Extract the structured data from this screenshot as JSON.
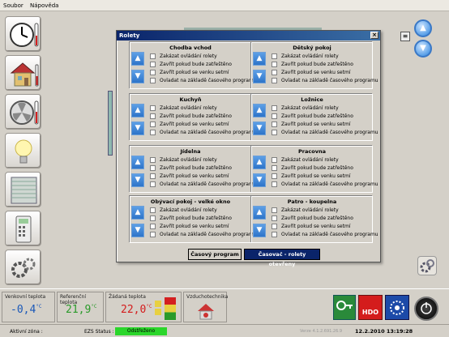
{
  "menu": [
    "Soubor",
    "Nápověda"
  ],
  "dialog": {
    "title": "Rolety",
    "close": "×",
    "rooms": [
      {
        "name": "Chodba vchod"
      },
      {
        "name": "Dětský pokoj"
      },
      {
        "name": "Kuchyň"
      },
      {
        "name": "Ložnice"
      },
      {
        "name": "Jídelna"
      },
      {
        "name": "Pracovna"
      },
      {
        "name": "Obývací pokoj - velké okno"
      },
      {
        "name": "Patro - koupelna"
      }
    ],
    "options": [
      "Zakázat ovládání rolety",
      "Zavřít pokud bude zatřeštěno",
      "Zavřít pokud se venku setmí",
      "Ovladat na základě časového programu"
    ],
    "buttons": {
      "program": "Časový program",
      "timer": "Časovač - rolety otevřeny"
    },
    "arrows": {
      "up": "▲",
      "down": "▼"
    }
  },
  "footer": {
    "outdoor_label": "Venkovní teplota",
    "outdoor_value": "-0,4",
    "reference_label": "Referenční teplota",
    "reference_value": "21,9",
    "target_label": "Žádaná teplota",
    "target_value": "22,0",
    "unit": "°C",
    "vent_label": "Vzduchotechnika",
    "hdo": "HDO",
    "active_zone_label": "Aktivní zóna :",
    "ezs_label": "EZS Status :",
    "ezs_value": "Odstřeženo",
    "version": "Verze 4.1.2.691.26.9",
    "datetime": "12.2.2010  13:19:28"
  },
  "colors": {
    "ezs": "#2bd62b",
    "outdoor": "#1a58b8",
    "reference": "#2a9a2a",
    "target": "#d41c1c"
  }
}
